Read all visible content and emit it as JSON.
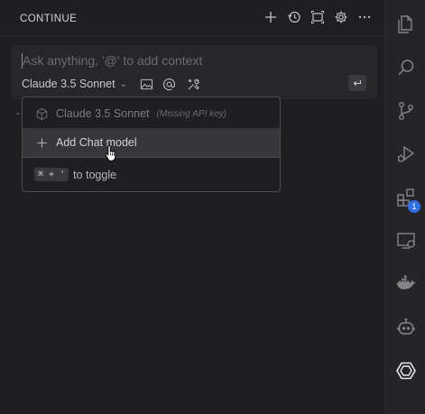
{
  "panel": {
    "title": "CONTINUE",
    "header_icons": [
      "plus-icon",
      "history-icon",
      "fullscreen-icon",
      "gear-icon",
      "more-icon"
    ]
  },
  "input": {
    "placeholder": "Ask anything, '@' to add context",
    "model": "Claude 3.5 Sonnet",
    "tool_icons": [
      "image-icon",
      "at-sign-icon",
      "tools-icon"
    ],
    "enter_icon": "enter-icon"
  },
  "dropdown": {
    "items": [
      {
        "label": "Claude 3.5 Sonnet",
        "note": "(Missing API key)",
        "icon": "cube-icon"
      },
      {
        "label": "Add Chat model",
        "icon": "plus-icon"
      }
    ],
    "shortcut": "⌘ + '",
    "shortcut_text": "to toggle"
  },
  "activity_bar": {
    "items": [
      "explorer-icon",
      "search-icon",
      "source-control-icon",
      "run-debug-icon",
      "extensions-icon",
      "remote-explorer-icon",
      "docker-icon",
      "copilot-icon",
      "continue-icon"
    ],
    "extensions_badge": "1"
  },
  "colors": {
    "badge": "#2f6fe6",
    "panel_bg": "#1f1f22",
    "activity_bg": "#252528"
  }
}
